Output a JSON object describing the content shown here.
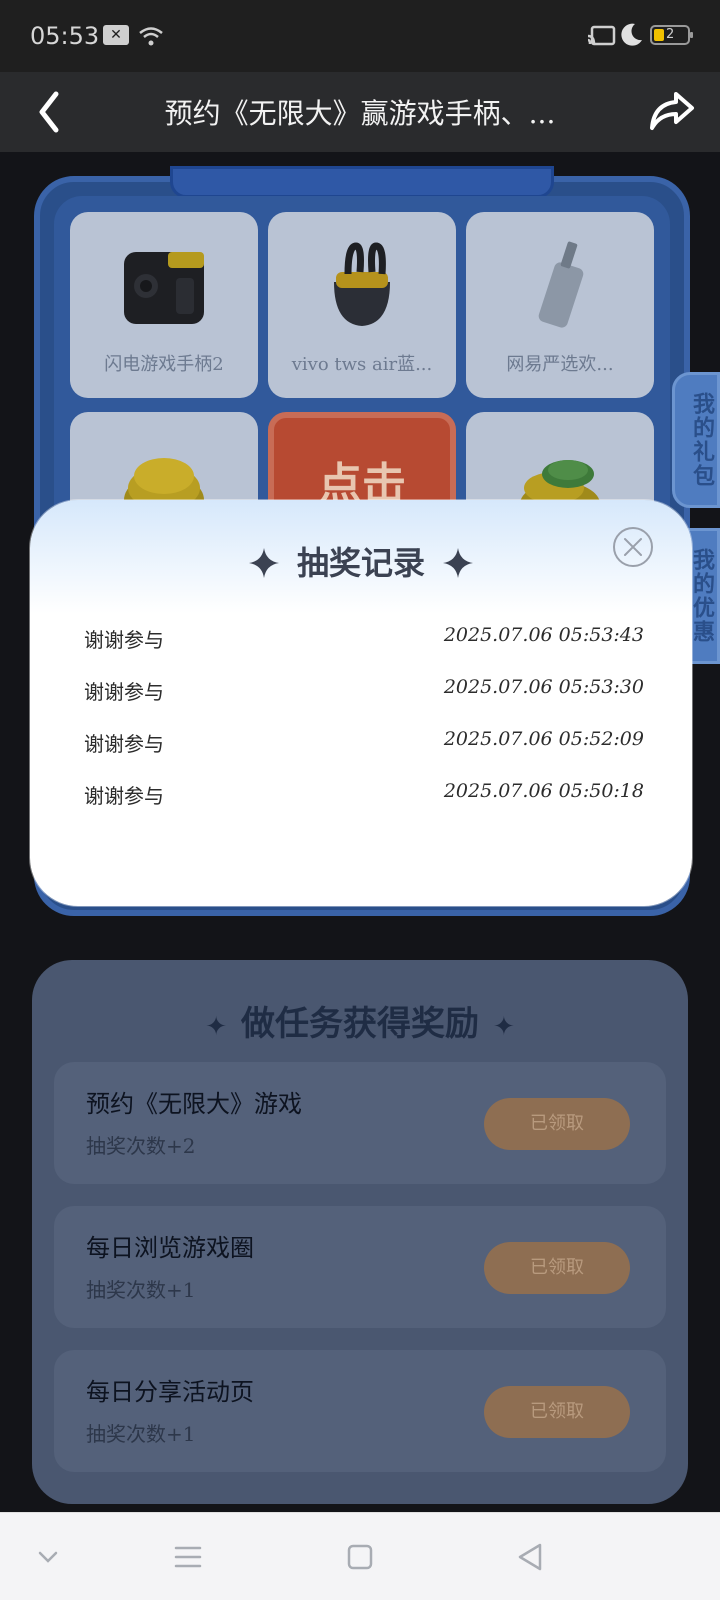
{
  "status_bar": {
    "time": "05:53",
    "battery_level": "2",
    "x_badge": "✕"
  },
  "header": {
    "title": "预约《无限大》赢游戏手柄、..."
  },
  "prizes": [
    {
      "name": "闪电游戏手柄2",
      "icon": "gamepad-icon"
    },
    {
      "name": "vivo tws air蓝...",
      "icon": "earbuds-icon"
    },
    {
      "name": "网易严选欢...",
      "icon": "usb-drive-icon"
    },
    {
      "name": "",
      "icon": "gold-coins-icon"
    },
    {
      "name": "",
      "icon": "coin-stack-icon"
    }
  ],
  "draw_button": {
    "label": "点击"
  },
  "side_tabs": {
    "gifts": "我的礼包",
    "coupons": "我的优惠券"
  },
  "task_panel": {
    "title": "做任务获得奖励",
    "tasks": [
      {
        "name": "预约《无限大》游戏",
        "sub": "抽奖次数+2",
        "button": "已领取"
      },
      {
        "name": "每日浏览游戏圈",
        "sub": "抽奖次数+1",
        "button": "已领取"
      },
      {
        "name": "每日分享活动页",
        "sub": "抽奖次数+1",
        "button": "已领取"
      }
    ]
  },
  "modal": {
    "title": "抽奖记录",
    "records": [
      {
        "name": "谢谢参与",
        "time": "2025.07.06  05:53:43"
      },
      {
        "name": "谢谢参与",
        "time": "2025.07.06  05:53:30"
      },
      {
        "name": "谢谢参与",
        "time": "2025.07.06  05:52:09"
      },
      {
        "name": "谢谢参与",
        "time": "2025.07.06  05:50:18"
      }
    ]
  },
  "colors": {
    "board_blue": "#2a4f8a",
    "modal_top": "#d6e8fb",
    "accent_orange": "#b74a32"
  }
}
